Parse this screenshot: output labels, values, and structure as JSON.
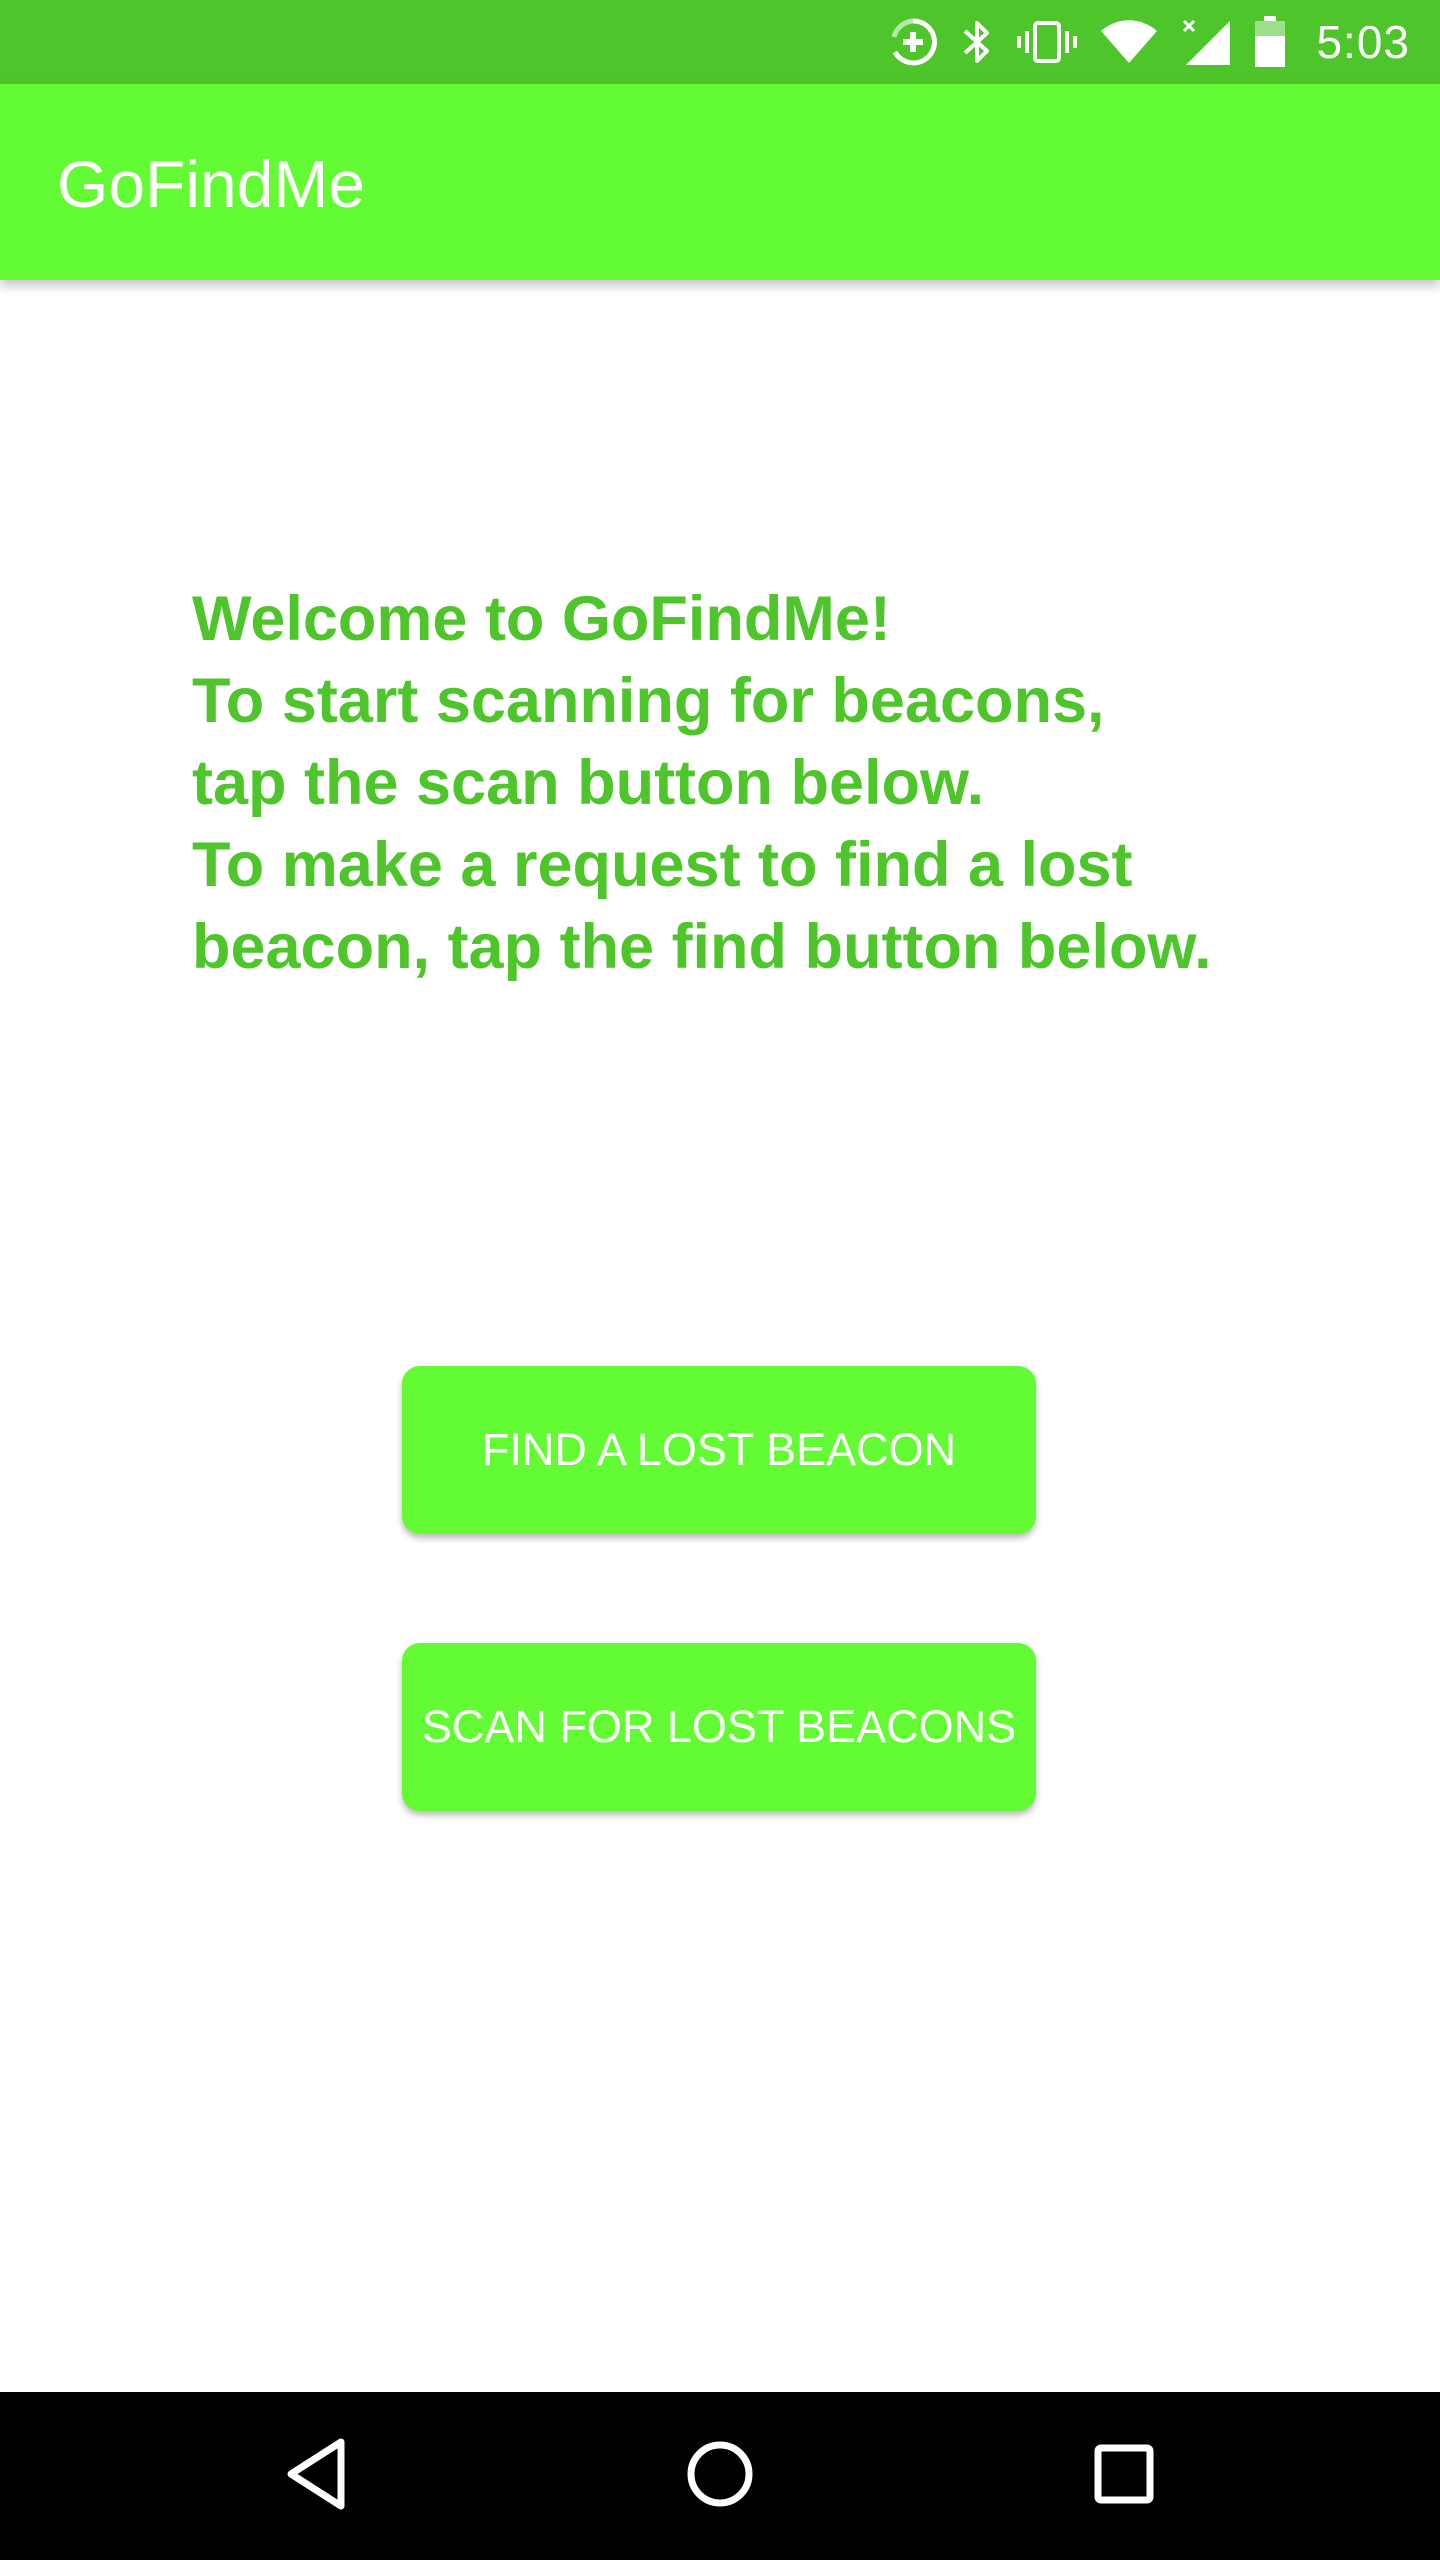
{
  "status_bar": {
    "time": "5:03",
    "icons": [
      "data-saver-icon",
      "bluetooth-icon",
      "vibrate-icon",
      "wifi-icon",
      "cell-signal-icon",
      "battery-icon"
    ],
    "color": "#4ec52a"
  },
  "app_bar": {
    "title": "GoFindMe",
    "color": "#63fb33"
  },
  "main": {
    "welcome_lines": [
      "Welcome to GoFindMe!",
      "To start scanning for beacons,",
      "tap the scan button below.",
      "To make a request to find a lost",
      "beacon, tap the find button below."
    ],
    "text_color": "#4ec52a",
    "buttons": {
      "find_label": "FIND A LOST BEACON",
      "scan_label": "SCAN FOR LOST BEACONS",
      "color": "#63fb33"
    }
  },
  "nav_bar": {
    "icons": [
      "back-icon",
      "home-icon",
      "recents-icon"
    ]
  }
}
